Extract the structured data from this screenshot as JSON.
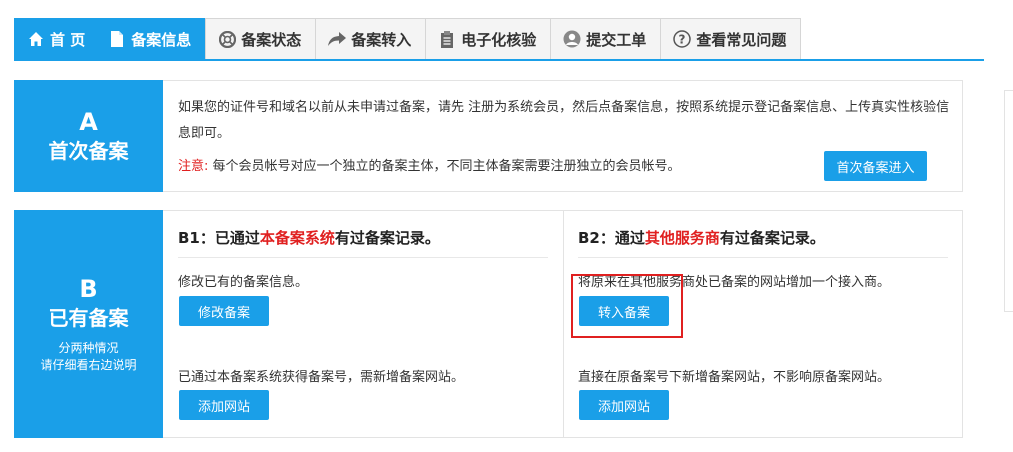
{
  "tabs": [
    {
      "label": "首 页",
      "icon": "home-icon"
    },
    {
      "label": "备案信息",
      "icon": "document-icon"
    },
    {
      "label": "备案状态",
      "icon": "lifebuoy-icon"
    },
    {
      "label": "备案转入",
      "icon": "share-arrow-icon"
    },
    {
      "label": "电子化核验",
      "icon": "clipboard-icon"
    },
    {
      "label": "提交工单",
      "icon": "user-icon"
    },
    {
      "label": "查看常见问题",
      "icon": "question-icon"
    }
  ],
  "section_a": {
    "letter": "A",
    "title": "首次备案",
    "description": "如果您的证件号和域名以前从未申请过备案，请先 注册为系统会员，然后点备案信息，按照系统提示登记备案信息、上传真实性核验信息即可。",
    "note_label": "注意:",
    "note_text": "每个会员帐号对应一个独立的备案主体，不同主体备案需要注册独立的会员帐号。",
    "button": "首次备案进入"
  },
  "section_b": {
    "letter": "B",
    "title": "已有备案",
    "note_line1": "分两种情况",
    "note_line2": "请仔细看右边说明",
    "b1": {
      "head_prefix": "B1：已通过",
      "head_highlight": "本备案系统",
      "head_suffix": "有过备案记录。",
      "item1_text": "修改已有的备案信息。",
      "item1_button": "修改备案",
      "item2_text": "已通过本备案系统获得备案号，需新增备案网站。",
      "item2_button": "添加网站"
    },
    "b2": {
      "head_prefix": "B2：通过",
      "head_highlight": "其他服务商",
      "head_suffix": "有过备案记录。",
      "item1_text": "将原来在其他服务商处已备案的网站增加一个接入商。",
      "item1_button": "转入备案",
      "item2_text": "直接在原备案号下新增备案网站，不影响原备案网站。",
      "item2_button": "添加网站"
    }
  },
  "colors": {
    "accent": "#1a9fe8",
    "highlight_red": "#e02020"
  }
}
